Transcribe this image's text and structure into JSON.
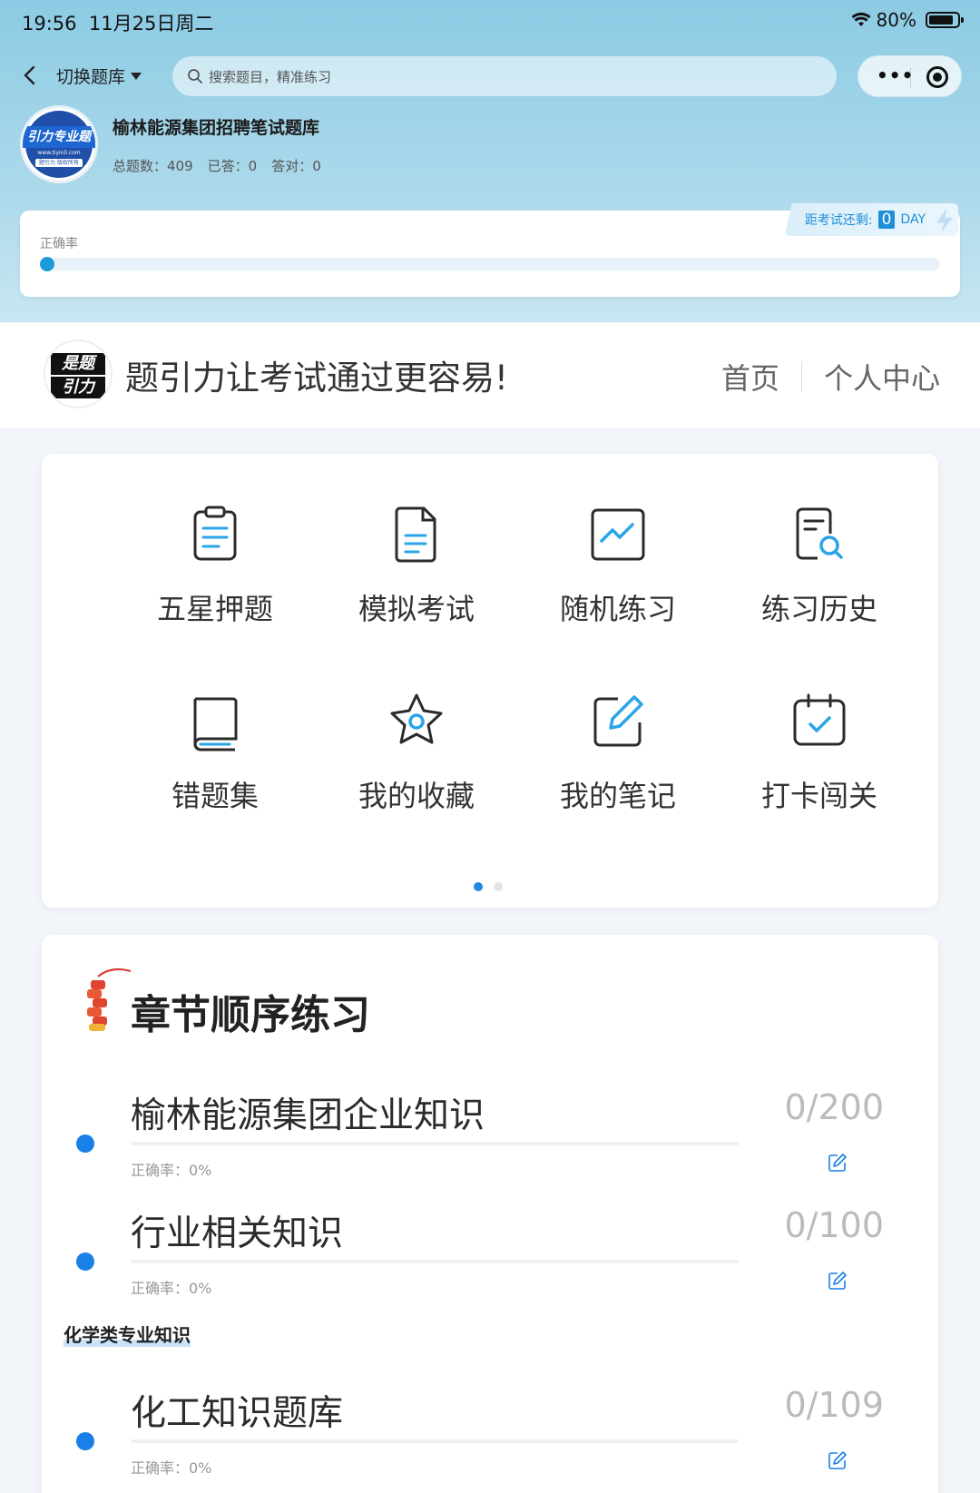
{
  "status_bar": {
    "time": "19:56",
    "date": "11月25日周二",
    "battery": "80%"
  },
  "nav": {
    "switch_label": "切换题库",
    "search_placeholder": "搜索题目，精准练习"
  },
  "library": {
    "title": "榆林能源集团招聘笔试题库",
    "logo_text": "引力专业题",
    "logo_url": "www.tiyinli.com",
    "logo_copyright": "题引力 版权所有",
    "stats": {
      "total": "总题数：409",
      "answered": "已答：0",
      "correct": "答对：0"
    },
    "accuracy_label": "正确率",
    "accuracy_value": 0,
    "countdown": {
      "label": "距考试还剩:",
      "value": "0",
      "unit": "DAY"
    }
  },
  "brand": {
    "logo_top": "是题",
    "logo_bottom": "引力",
    "slogan": "题引力让考试通过更容易!",
    "nav_home": "首页",
    "nav_profile": "个人中心"
  },
  "features": [
    {
      "label": "五星押题",
      "icon": "clipboard-icon"
    },
    {
      "label": "模拟考试",
      "icon": "document-icon"
    },
    {
      "label": "随机练习",
      "icon": "chart-line-icon"
    },
    {
      "label": "练习历史",
      "icon": "history-search-icon"
    },
    {
      "label": "错题集",
      "icon": "book-icon"
    },
    {
      "label": "我的收藏",
      "icon": "star-icon"
    },
    {
      "label": "我的笔记",
      "icon": "pencil-note-icon"
    },
    {
      "label": "打卡闯关",
      "icon": "calendar-check-icon"
    }
  ],
  "pager": {
    "pages": 2,
    "active": 1
  },
  "chapters": {
    "title": "章节顺序练习",
    "section_label": "化学类专业知识",
    "items": [
      {
        "name": "榆林能源集团企业知识",
        "count": "0/200",
        "accuracy": "正确率：0%"
      },
      {
        "name": "行业相关知识",
        "count": "0/100",
        "accuracy": "正确率：0%"
      },
      {
        "name": "化工知识题库",
        "count": "0/109",
        "accuracy": "正确率：0%"
      }
    ]
  },
  "colors": {
    "accent": "#1e88e5",
    "icon_blue": "#2aa5e8",
    "icon_dark": "#2b2b2b"
  }
}
